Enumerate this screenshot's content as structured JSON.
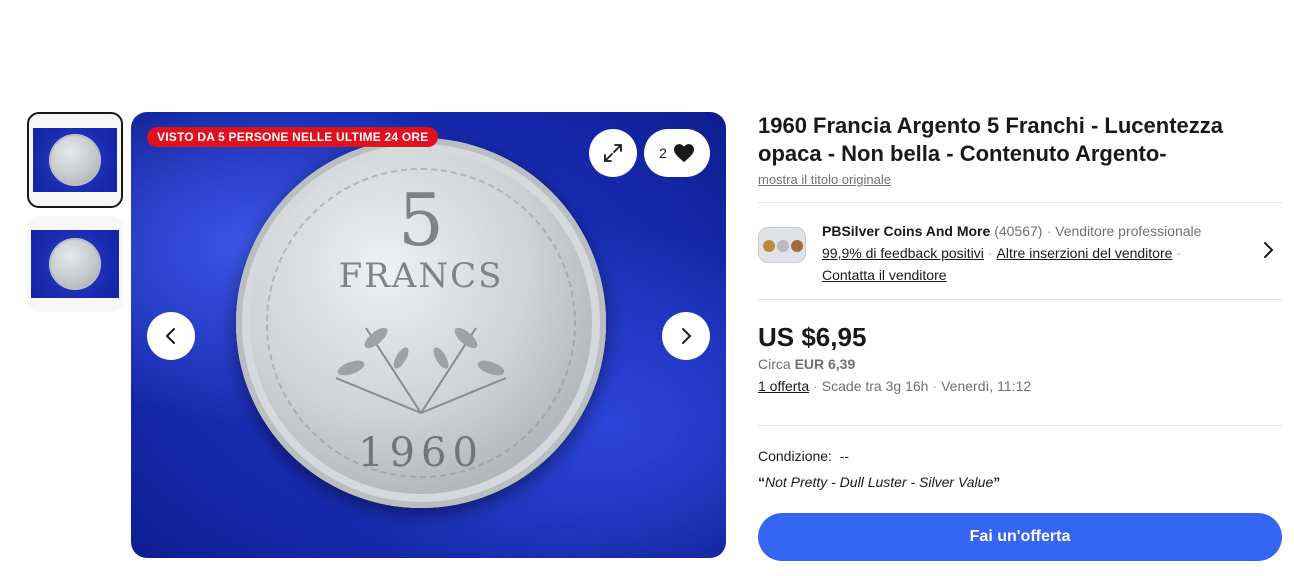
{
  "gallery": {
    "views_badge": "VISTO DA 5 PERSONE NELLE ULTIME 24 ORE",
    "watch_count": "2",
    "coin": {
      "value": "5",
      "unit": "FRANCS",
      "year": "1960"
    },
    "icons": [
      "expand-icon",
      "heart-icon",
      "chevron-left-icon",
      "chevron-right-icon"
    ]
  },
  "listing": {
    "title": "1960 Francia Argento 5 Franchi - Lucentezza opaca - Non bella - Contenuto Argento-",
    "show_original_title": "mostra il titolo originale"
  },
  "seller": {
    "name": "PBSilver Coins And More",
    "rating_count": "(40567)",
    "type": "Venditore professionale",
    "feedback": "99,9% di feedback positivi",
    "other_listings": "Altre inserzioni del venditore",
    "contact": "Contatta il venditore"
  },
  "price": {
    "amount": "US $6,95",
    "approx_label": "Circa",
    "approx_value": "EUR 6,39",
    "offers": "1 offerta",
    "expires": "Scade tra 3g 16h",
    "end_time": "Venerdì, 11:12"
  },
  "condition": {
    "label": "Condizione:",
    "value": "--",
    "quote": "Not Pretty - Dull Luster - Silver Value"
  },
  "actions": {
    "make_offer": "Fai un'offerta"
  },
  "colors": {
    "primary_button": "#3665f3",
    "badge_red": "#e0101c",
    "text": "#191919",
    "muted": "#707070"
  }
}
